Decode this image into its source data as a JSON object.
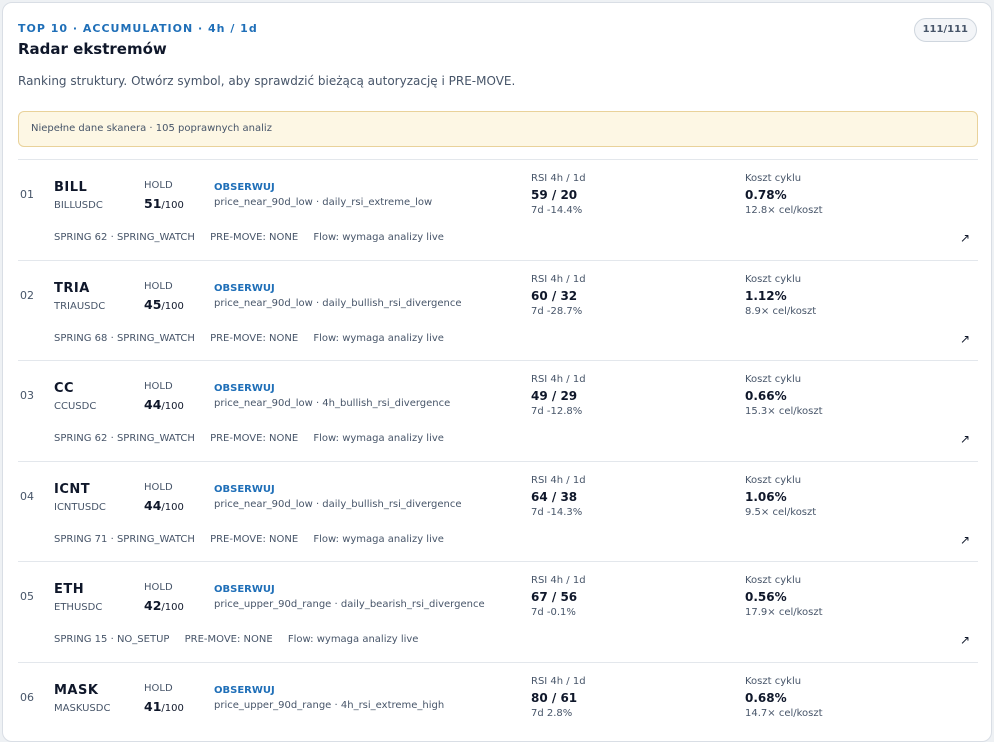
{
  "header": {
    "eyebrow": "TOP 10 · ACCUMULATION · 4h / 1d",
    "title": "Radar ekstremów",
    "count_badge": "111/111",
    "description": "Ranking struktury. Otwórz symbol, aby sprawdzić bieżącą autoryzację i PRE-MOVE.",
    "warning": "Niepełne dane skanera · 105 poprawnych analiz"
  },
  "labels": {
    "hold": "HOLD",
    "hold_max": "/100",
    "rsi": "RSI 4h / 1d",
    "cost": "Koszt cyklu",
    "open_icon": "↗"
  },
  "rows": [
    {
      "rank": "01",
      "symbol": "BILL",
      "pair": "BILLUSDC",
      "hold": "51",
      "action": "OBSERWUJ",
      "reasons": "price_near_90d_low · daily_rsi_extreme_low",
      "rsi": "59 / 20",
      "rsi_change": "7d -14.4%",
      "cost": "0.78%",
      "cost_ratio": "12.8× cel/koszt",
      "spring": "SPRING 62 · SPRING_WATCH",
      "premove": "PRE-MOVE: NONE",
      "flow": "Flow: wymaga analizy live"
    },
    {
      "rank": "02",
      "symbol": "TRIA",
      "pair": "TRIAUSDC",
      "hold": "45",
      "action": "OBSERWUJ",
      "reasons": "price_near_90d_low · daily_bullish_rsi_divergence",
      "rsi": "60 / 32",
      "rsi_change": "7d -28.7%",
      "cost": "1.12%",
      "cost_ratio": "8.9× cel/koszt",
      "spring": "SPRING 68 · SPRING_WATCH",
      "premove": "PRE-MOVE: NONE",
      "flow": "Flow: wymaga analizy live"
    },
    {
      "rank": "03",
      "symbol": "CC",
      "pair": "CCUSDC",
      "hold": "44",
      "action": "OBSERWUJ",
      "reasons": "price_near_90d_low · 4h_bullish_rsi_divergence",
      "rsi": "49 / 29",
      "rsi_change": "7d -12.8%",
      "cost": "0.66%",
      "cost_ratio": "15.3× cel/koszt",
      "spring": "SPRING 62 · SPRING_WATCH",
      "premove": "PRE-MOVE: NONE",
      "flow": "Flow: wymaga analizy live"
    },
    {
      "rank": "04",
      "symbol": "ICNT",
      "pair": "ICNTUSDC",
      "hold": "44",
      "action": "OBSERWUJ",
      "reasons": "price_near_90d_low · daily_bullish_rsi_divergence",
      "rsi": "64 / 38",
      "rsi_change": "7d -14.3%",
      "cost": "1.06%",
      "cost_ratio": "9.5× cel/koszt",
      "spring": "SPRING 71 · SPRING_WATCH",
      "premove": "PRE-MOVE: NONE",
      "flow": "Flow: wymaga analizy live"
    },
    {
      "rank": "05",
      "symbol": "ETH",
      "pair": "ETHUSDC",
      "hold": "42",
      "action": "OBSERWUJ",
      "reasons": "price_upper_90d_range · daily_bearish_rsi_divergence",
      "rsi": "67 / 56",
      "rsi_change": "7d -0.1%",
      "cost": "0.56%",
      "cost_ratio": "17.9× cel/koszt",
      "spring": "SPRING 15 · NO_SETUP",
      "premove": "PRE-MOVE: NONE",
      "flow": "Flow: wymaga analizy live"
    },
    {
      "rank": "06",
      "symbol": "MASK",
      "pair": "MASKUSDC",
      "hold": "41",
      "action": "OBSERWUJ",
      "reasons": "price_upper_90d_range · 4h_rsi_extreme_high",
      "rsi": "80 / 61",
      "rsi_change": "7d 2.8%",
      "cost": "0.68%",
      "cost_ratio": "14.7× cel/koszt",
      "spring": "",
      "premove": "",
      "flow": ""
    }
  ]
}
